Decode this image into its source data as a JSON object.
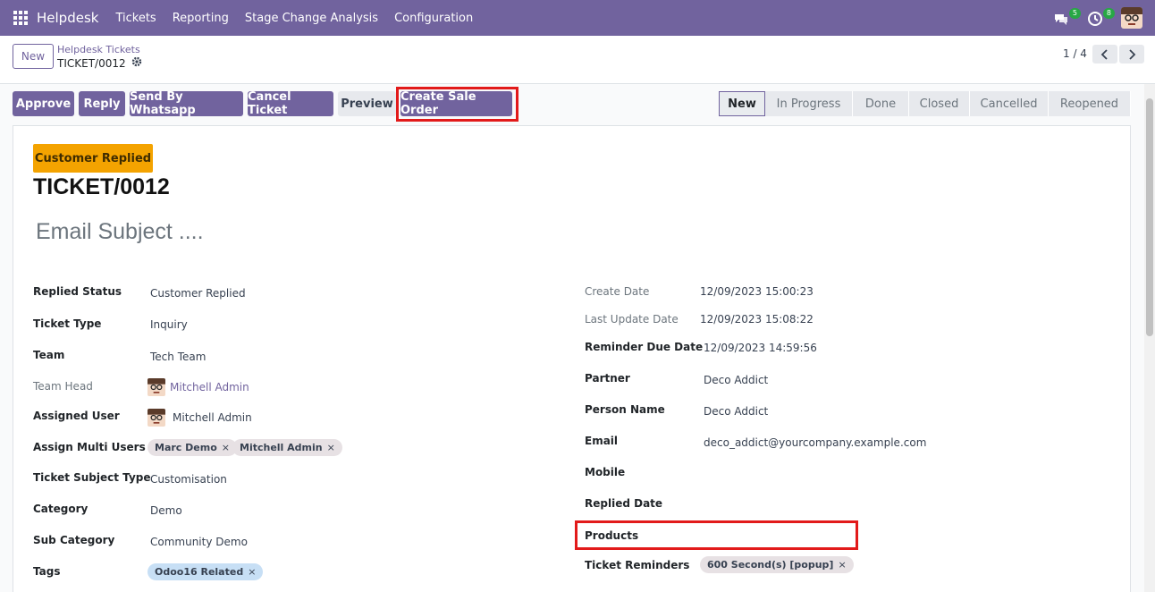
{
  "nav": {
    "brand": "Helpdesk",
    "menu": [
      "Tickets",
      "Reporting",
      "Stage Change Analysis",
      "Configuration"
    ],
    "chat_badge": "5",
    "activity_badge": "8"
  },
  "control": {
    "new_label": "New",
    "breadcrumb_parent": "Helpdesk Tickets",
    "breadcrumb_current": "TICKET/0012",
    "pager": "1 / 4"
  },
  "actions": {
    "approve": "Approve",
    "reply": "Reply",
    "whatsapp": "Send By Whatsapp",
    "cancel": "Cancel Ticket",
    "preview": "Preview",
    "sale_order": "Create Sale Order"
  },
  "stages": [
    "New",
    "In Progress",
    "Done",
    "Closed",
    "Cancelled",
    "Reopened"
  ],
  "ticket": {
    "status_tag": "Customer Replied",
    "number": "TICKET/0012",
    "subject_placeholder": "Email Subject ...."
  },
  "left_fields": {
    "replied_status": {
      "label": "Replied Status",
      "value": "Customer Replied"
    },
    "ticket_type": {
      "label": "Ticket Type",
      "value": "Inquiry"
    },
    "team": {
      "label": "Team",
      "value": "Tech Team"
    },
    "team_head": {
      "label": "Team Head",
      "value": "Mitchell Admin"
    },
    "assigned_user": {
      "label": "Assigned User",
      "value": "Mitchell Admin"
    },
    "multi_users": {
      "label": "Assign Multi Users",
      "values": [
        "Marc Demo",
        "Mitchell Admin"
      ]
    },
    "subject_type": {
      "label": "Ticket Subject Type",
      "value": "Customisation"
    },
    "category": {
      "label": "Category",
      "value": "Demo"
    },
    "sub_category": {
      "label": "Sub Category",
      "value": "Community Demo"
    },
    "tags": {
      "label": "Tags",
      "values": [
        "Odoo16 Related"
      ]
    }
  },
  "right_fields": {
    "create_date": {
      "label": "Create Date",
      "value": "12/09/2023 15:00:23"
    },
    "last_update": {
      "label": "Last Update Date",
      "value": "12/09/2023 15:08:22"
    },
    "reminder_due": {
      "label": "Reminder Due Date",
      "value": "12/09/2023 14:59:56"
    },
    "partner": {
      "label": "Partner",
      "value": "Deco Addict"
    },
    "person_name": {
      "label": "Person Name",
      "value": "Deco Addict"
    },
    "email": {
      "label": "Email",
      "value": "deco_addict@yourcompany.example.com"
    },
    "mobile": {
      "label": "Mobile",
      "value": ""
    },
    "replied_date": {
      "label": "Replied Date",
      "value": ""
    },
    "products": {
      "label": "Products",
      "value": ""
    },
    "reminders": {
      "label": "Ticket Reminders",
      "values": [
        "600 Second(s) [popup]"
      ]
    }
  },
  "colors": {
    "brand": "#71639e",
    "highlight": "#e21a1a",
    "tag_warning": "#f4a300"
  }
}
